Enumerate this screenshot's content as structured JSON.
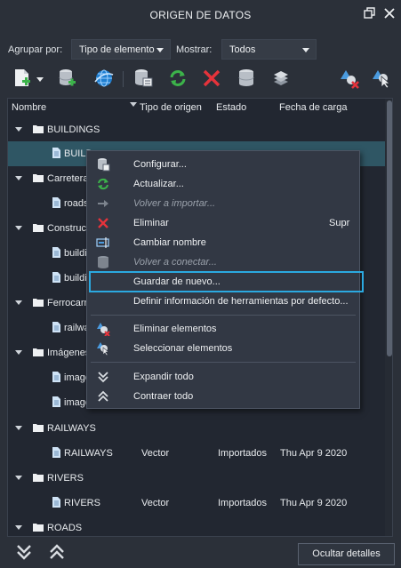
{
  "window": {
    "title": "ORIGEN DE DATOS"
  },
  "filters": {
    "group_label": "Agrupar por:",
    "group_value": "Tipo de elemento",
    "show_label": "Mostrar:",
    "show_value": "Todos"
  },
  "columns": {
    "name": "Nombre",
    "source": "Tipo de origen",
    "state": "Estado",
    "date": "Fecha de carga"
  },
  "tree": {
    "buildings": {
      "group": "BUILDINGS",
      "child": "BUILD"
    },
    "carreteras": {
      "group": "Carreteras",
      "child": "roads"
    },
    "construcciones": {
      "group": "Construcc",
      "child1": "buildin",
      "child2": "buildin"
    },
    "ferrocarril": {
      "group": "Ferrocarril",
      "child": "railwa"
    },
    "imagenes": {
      "group": "Imágenes",
      "child1": "image",
      "child2": "image"
    },
    "railways": {
      "group": "RAILWAYS",
      "child": "RAILWAYS",
      "source": "Vector",
      "state": "Importados",
      "date": "Thu Apr 9 2020"
    },
    "rivers": {
      "group": "RIVERS",
      "child": "RIVERS",
      "source": "Vector",
      "state": "Importados",
      "date": "Thu Apr 9 2020"
    },
    "roads": {
      "group": "ROADS"
    }
  },
  "context_menu": {
    "configurar": "Configurar...",
    "actualizar": "Actualizar...",
    "volver_importar": "Volver a importar...",
    "eliminar": "Eliminar",
    "eliminar_shortcut": "Supr",
    "cambiar_nombre": "Cambiar nombre",
    "volver_conectar": "Volver a conectar...",
    "guardar_nuevo": "Guardar de nuevo...",
    "definir_info": "Definir información de herramientas por defecto...",
    "eliminar_elementos": "Eliminar elementos",
    "seleccionar_elementos": "Seleccionar elementos",
    "expandir_todo": "Expandir todo",
    "contraer_todo": "Contraer todo"
  },
  "footer": {
    "hide_details": "Ocultar detalles"
  },
  "colors": {
    "accent": "#2ba9e0",
    "selection": "#2f5664",
    "panel": "#222731",
    "background": "#2b3039"
  }
}
